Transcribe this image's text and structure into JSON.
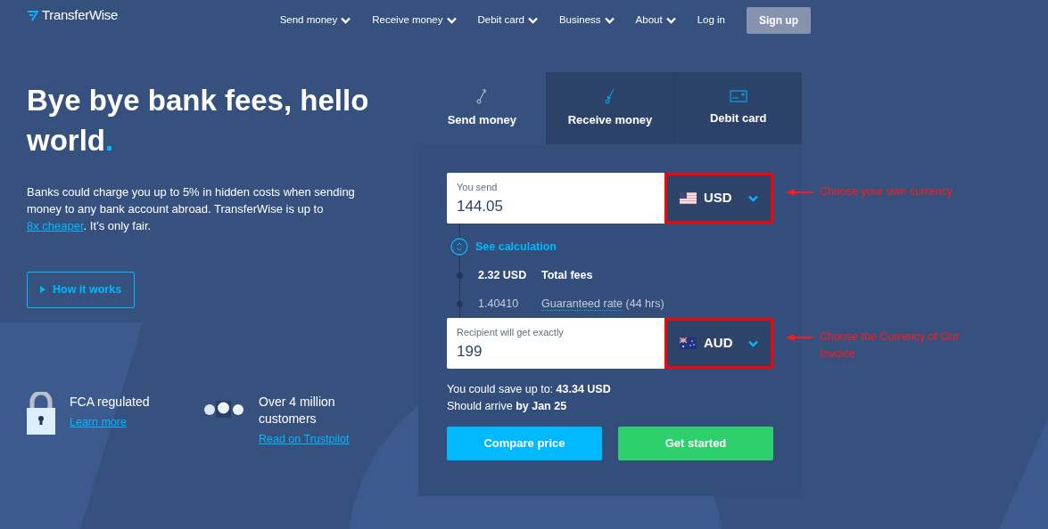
{
  "header": {
    "logo": "TransferWise",
    "nav": [
      {
        "label": "Send money",
        "dropdown": true
      },
      {
        "label": "Receive money",
        "dropdown": true
      },
      {
        "label": "Debit card",
        "dropdown": true
      },
      {
        "label": "Business",
        "dropdown": true
      },
      {
        "label": "About",
        "dropdown": true
      },
      {
        "label": "Log in",
        "dropdown": false
      }
    ],
    "signup": "Sign up"
  },
  "hero": {
    "title": "Bye bye bank fees, hello world",
    "title_accent": ".",
    "description_before": "Banks could charge you up to 5% in hidden costs when sending money to any bank account abroad. TransferWise is up to ",
    "description_link": "8x cheaper",
    "description_after": ". It’s only fair.",
    "button": "How it works",
    "features": [
      {
        "kind": "lock",
        "title": "FCA regulated",
        "link": "Learn more"
      },
      {
        "kind": "people",
        "title": "Over 4 million customers",
        "link": "Read on Trustpilot"
      }
    ]
  },
  "card": {
    "tabs": [
      {
        "label": "Send money",
        "kind": "send",
        "selected": true
      },
      {
        "label": "Receive money",
        "kind": "receive",
        "selected": false
      },
      {
        "label": "Debit card",
        "kind": "card",
        "selected": false
      }
    ],
    "send": {
      "label": "You send",
      "value": "144.05",
      "currency": "USD",
      "kind": "us",
      "highlighted": true,
      "annotation": "Choose your own currency"
    },
    "calculation": {
      "toggle": "See calculation",
      "rows": [
        {
          "kind": "fee",
          "amount": "2.32 USD",
          "label": "Total fees"
        },
        {
          "kind": "rate",
          "amount": "1.40410",
          "label": "Guaranteed rate",
          "suffix": "(44 hrs)"
        }
      ]
    },
    "receive": {
      "label": "Recipient will get exactly",
      "value": "199",
      "currency": "AUD",
      "kind": "au",
      "highlighted": true,
      "annotation": "Choose the Currency of Our Invoice"
    },
    "savings": "You could save up to: **43.34 USD**",
    "arrival": "Should arrive **by Jan 25**",
    "buttons": [
      {
        "label": "Compare price",
        "kind": "compare"
      },
      {
        "label": "Get started",
        "kind": "start"
      }
    ]
  }
}
